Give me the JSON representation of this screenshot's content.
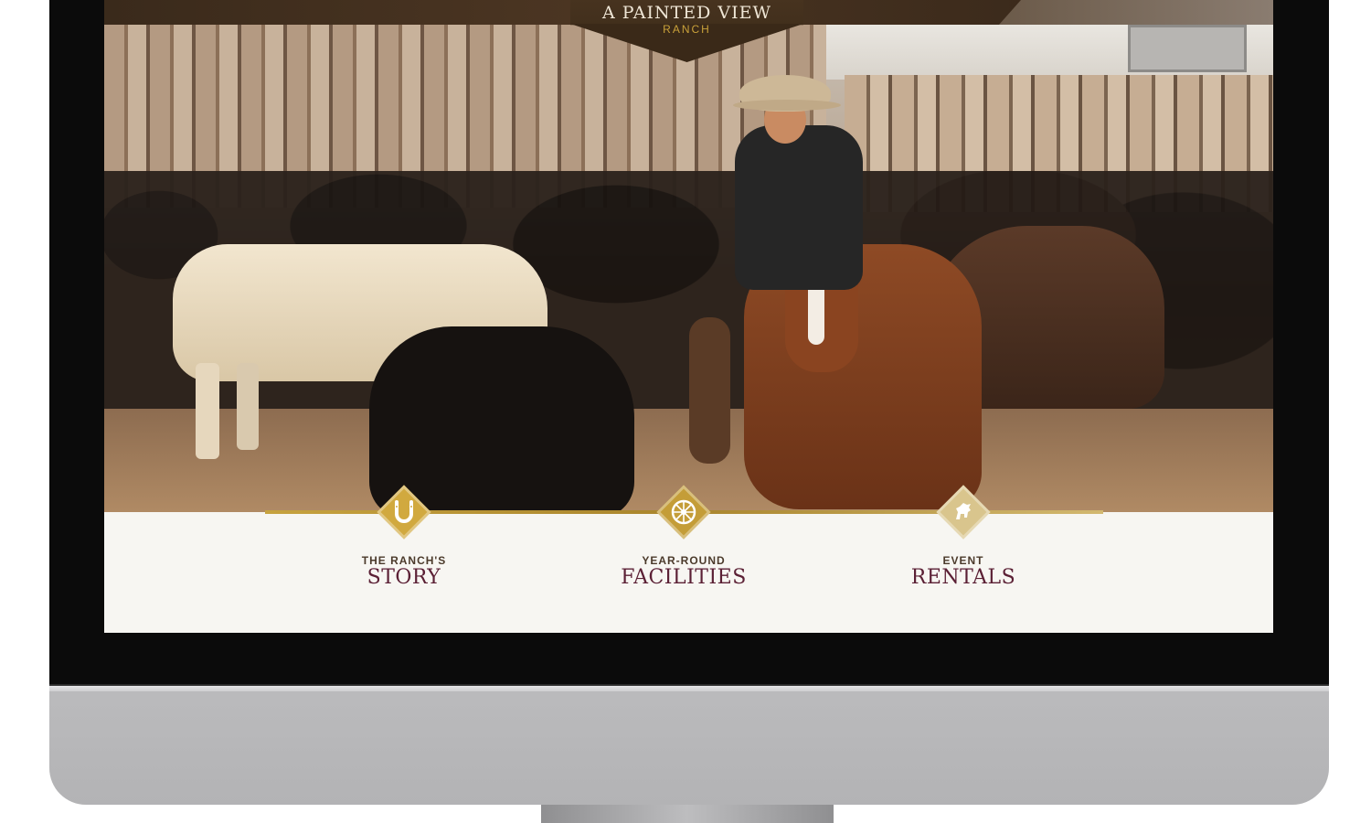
{
  "site": {
    "logo_title": "A PAINTED VIEW",
    "logo_subtitle": "RANCH"
  },
  "nav": [
    {
      "small": "THE RANCH'S",
      "big": "STORY",
      "icon": "horseshoe-icon",
      "color": "#d1a93f"
    },
    {
      "small": "YEAR-ROUND",
      "big": "FACILITIES",
      "icon": "wagon-wheel-icon",
      "color": "#c49d38"
    },
    {
      "small": "EVENT",
      "big": "RENTALS",
      "icon": "horse-icon",
      "color": "#d9c58d"
    }
  ],
  "colors": {
    "accent_gold": "#c6a23f",
    "heading_maroon": "#5b2035",
    "header_brown": "#3a2918"
  }
}
